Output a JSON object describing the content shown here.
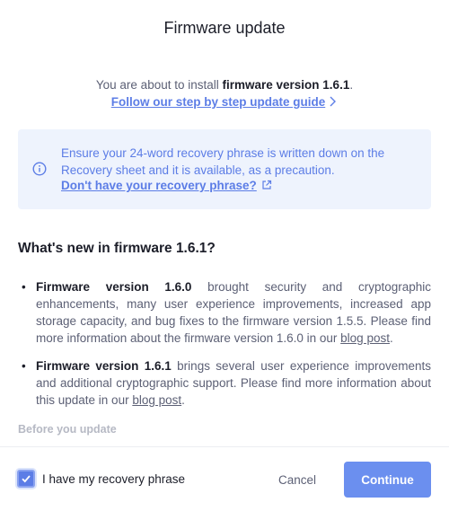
{
  "dialog": {
    "title": "Firmware update"
  },
  "intro": {
    "prefix": "You are about to install ",
    "version_bold": "firmware version 1.6.1",
    "suffix": ".",
    "guide_link": "Follow our step by step update guide"
  },
  "notice": {
    "text": "Ensure your 24-word recovery phrase is written down on the Recovery sheet and it is available, as a precaution.",
    "link": "Don't have your recovery phrase?",
    "icon": "info-icon",
    "link_icon": "external-link-icon"
  },
  "whats_new": {
    "heading": "What's new in firmware 1.6.1?",
    "notes": [
      {
        "bold": "Firmware version 1.6.0",
        "text": " brought security and cryptographic enhancements, many user experience improvements, increased app storage capacity, and bug fixes to the firmware version 1.5.5. Please find more information about the firmware version 1.6.0 in our ",
        "link": "blog post",
        "end": "."
      },
      {
        "bold": "Firmware version 1.6.1",
        "text": " brings several user experience improvements and additional cryptographic support. Please find more information about this update in our ",
        "link": "blog post",
        "end": "."
      }
    ],
    "next_section": "Before you update"
  },
  "footer": {
    "checkbox_label": "I have my recovery phrase",
    "checkbox_checked": true,
    "cancel_label": "Cancel",
    "continue_label": "Continue"
  },
  "colors": {
    "accent": "#5c7de6",
    "info_bg": "#eef3fd",
    "continue_bg": "#6b8fef"
  }
}
